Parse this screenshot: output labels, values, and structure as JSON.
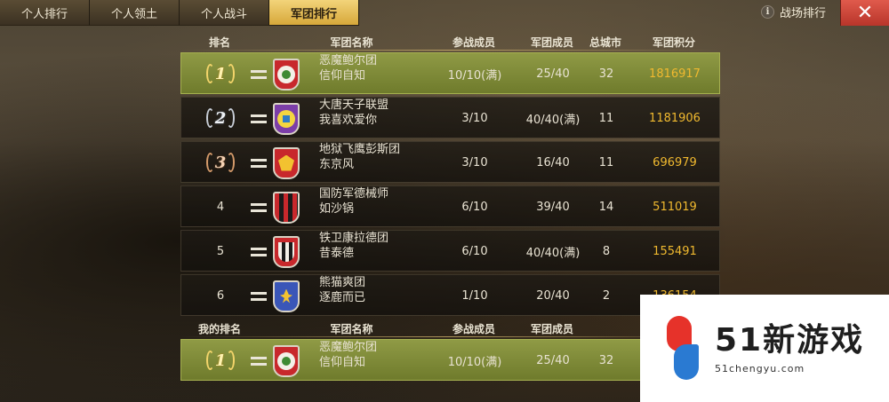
{
  "tabs": [
    {
      "label": "个人排行",
      "active": false
    },
    {
      "label": "个人领土",
      "active": false
    },
    {
      "label": "个人战斗",
      "active": false
    },
    {
      "label": "军团排行",
      "active": true
    }
  ],
  "top_right": {
    "info_icon_text": "i",
    "battle_rank_label": "战场排行",
    "close_symbol": "✕"
  },
  "colors": {
    "active_tab": "#f3d47a",
    "highlight_row": "#8f9a45",
    "score": "#f0b92f",
    "close": "#e05a4c"
  },
  "table": {
    "headers": {
      "rank": "排名",
      "name": "军团名称",
      "joined": "参战成员",
      "members": "军团成员",
      "cities": "总城市",
      "score": "军团积分"
    },
    "rows": [
      {
        "rank": "1",
        "medal": "gold",
        "change_icon": "equal-icon",
        "emblem": "shield-red-green",
        "name": "恶魔鲍尔团",
        "slogan": "信仰自知",
        "joined": "10/10(满)",
        "members": "25/40",
        "cities": "32",
        "score": "1816917",
        "highlight": true
      },
      {
        "rank": "2",
        "medal": "silver",
        "change_icon": "equal-icon",
        "emblem": "shield-purple-yellow",
        "name": "大唐天子联盟",
        "slogan": "我喜欢爱你",
        "joined": "3/10",
        "members": "40/40(满)",
        "cities": "11",
        "score": "1181906",
        "highlight": false
      },
      {
        "rank": "3",
        "medal": "bronze",
        "change_icon": "equal-icon",
        "emblem": "shield-red-eagle",
        "name": "地狱飞鹰彭斯团",
        "slogan": "东京风",
        "joined": "3/10",
        "members": "16/40",
        "cities": "11",
        "score": "696979",
        "highlight": false
      },
      {
        "rank": "4",
        "medal": "",
        "change_icon": "equal-icon",
        "emblem": "shield-red-stripes",
        "name": "国防军德械师",
        "slogan": "如沙锅",
        "joined": "6/10",
        "members": "39/40",
        "cities": "14",
        "score": "511019",
        "highlight": false
      },
      {
        "rank": "5",
        "medal": "",
        "change_icon": "equal-icon",
        "emblem": "shield-red-white-stripes",
        "name": "铁卫康拉德团",
        "slogan": "昔泰德",
        "joined": "6/10",
        "members": "40/40(满)",
        "cities": "8",
        "score": "155491",
        "highlight": false
      },
      {
        "rank": "6",
        "medal": "",
        "change_icon": "equal-icon",
        "emblem": "shield-blue-fleur",
        "name": "熊猫爽团",
        "slogan": "逐鹿而已",
        "joined": "1/10",
        "members": "20/40",
        "cities": "2",
        "score": "136154",
        "highlight": false
      }
    ],
    "my_headers": {
      "rank": "我的排名",
      "name": "军团名称",
      "joined": "参战成员",
      "members": "军团成员"
    },
    "my_row": {
      "rank": "1",
      "medal": "gold",
      "change_icon": "equal-icon",
      "emblem": "shield-red-green",
      "name": "恶魔鲍尔团",
      "slogan": "信仰自知",
      "joined": "10/10(满)",
      "members": "25/40",
      "cities": "32"
    }
  },
  "watermark": {
    "title": "51新游戏",
    "url": "51chengyu.com"
  }
}
